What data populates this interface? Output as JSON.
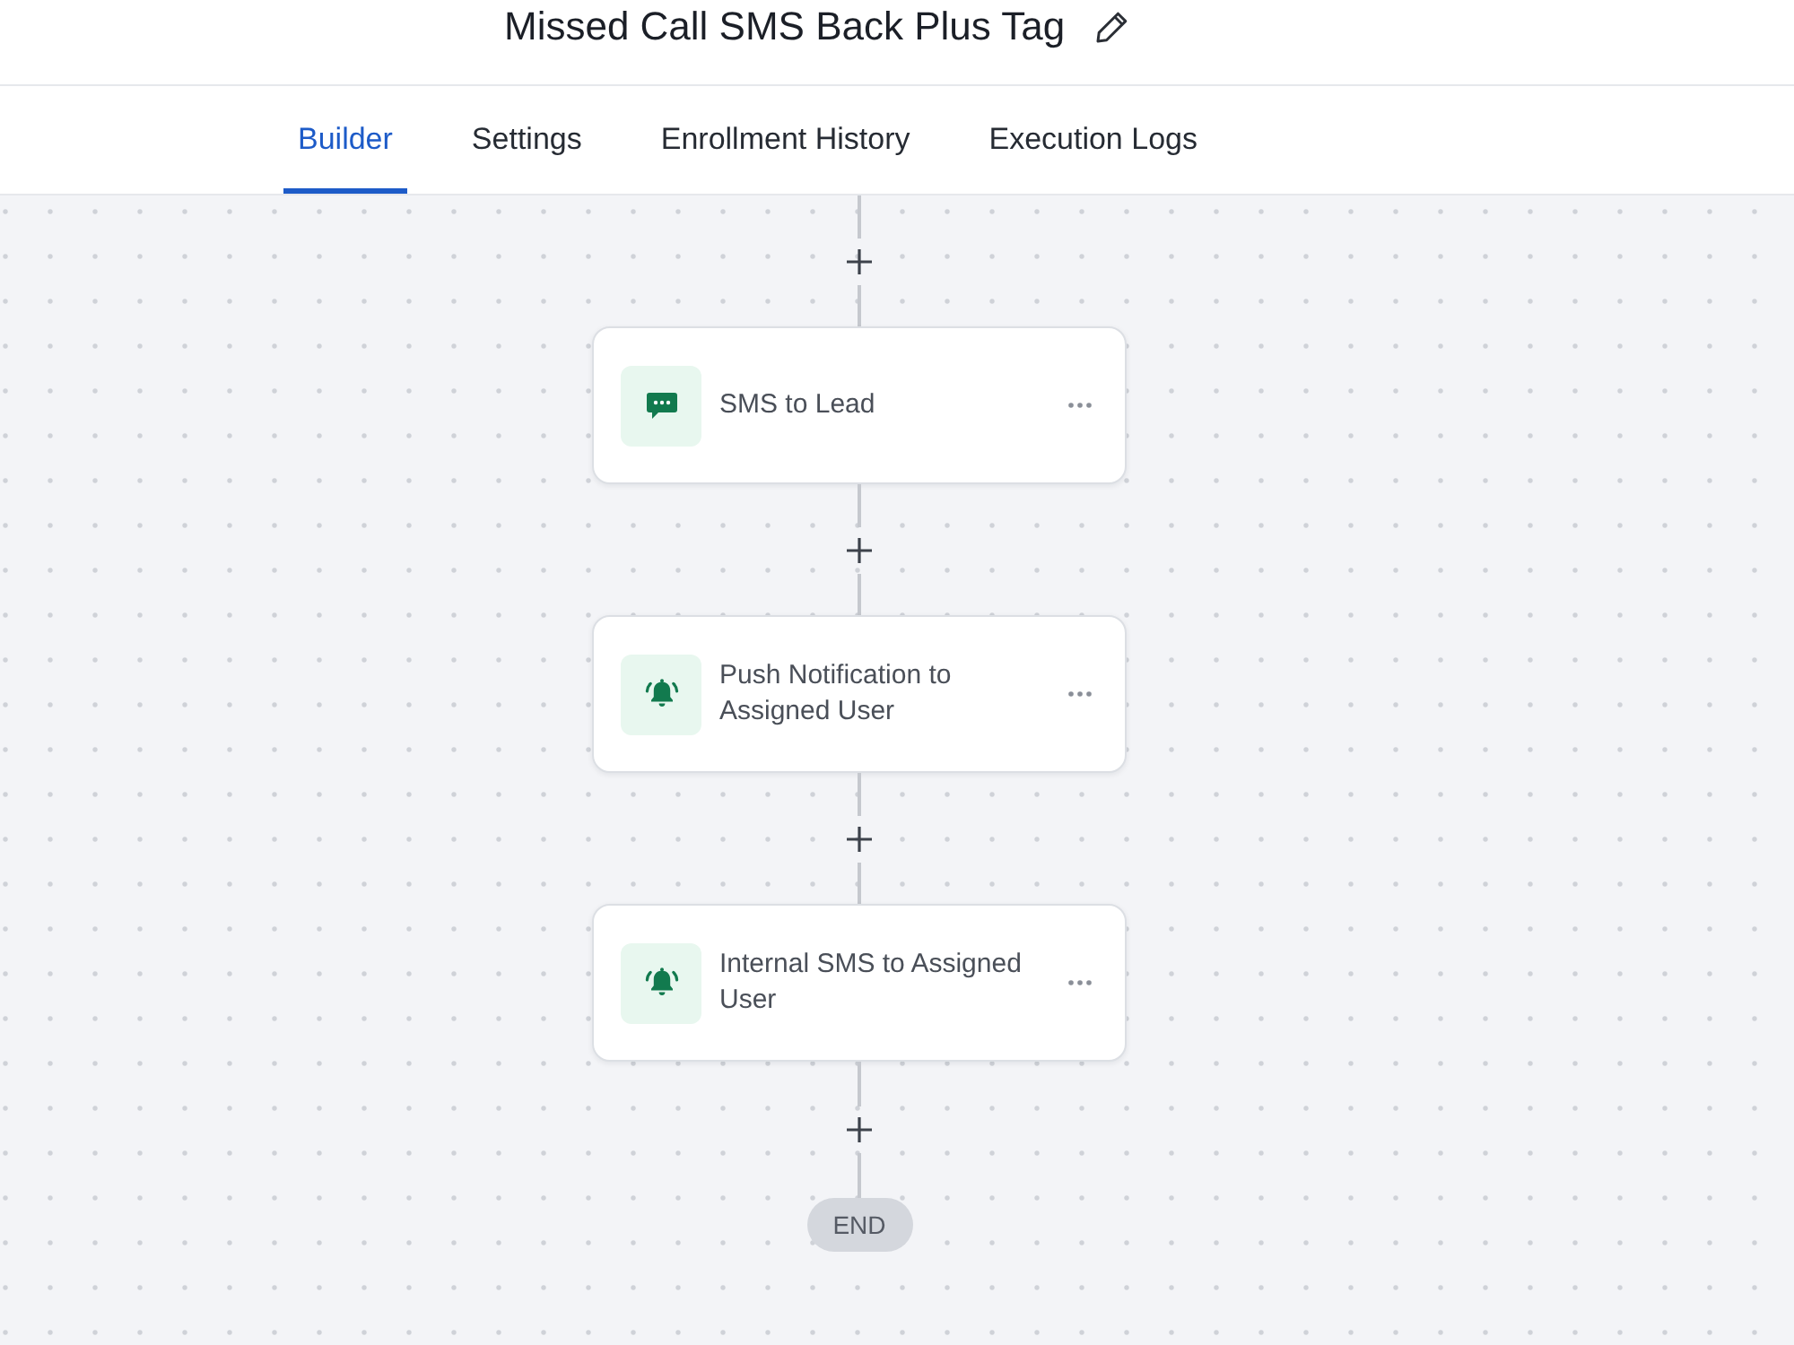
{
  "header": {
    "title": "Missed Call SMS Back Plus Tag"
  },
  "tabs": [
    {
      "label": "Builder",
      "selected": true
    },
    {
      "label": "Settings",
      "selected": false
    },
    {
      "label": "Enrollment History",
      "selected": false
    },
    {
      "label": "Execution Logs",
      "selected": false
    }
  ],
  "workflow": {
    "steps": [
      {
        "kind": "sms",
        "label": "SMS to Lead"
      },
      {
        "kind": "notification",
        "label": "Push Notification to Assigned User"
      },
      {
        "kind": "notification",
        "label": "Internal SMS to Assigned User"
      }
    ],
    "end_label": "END"
  }
}
